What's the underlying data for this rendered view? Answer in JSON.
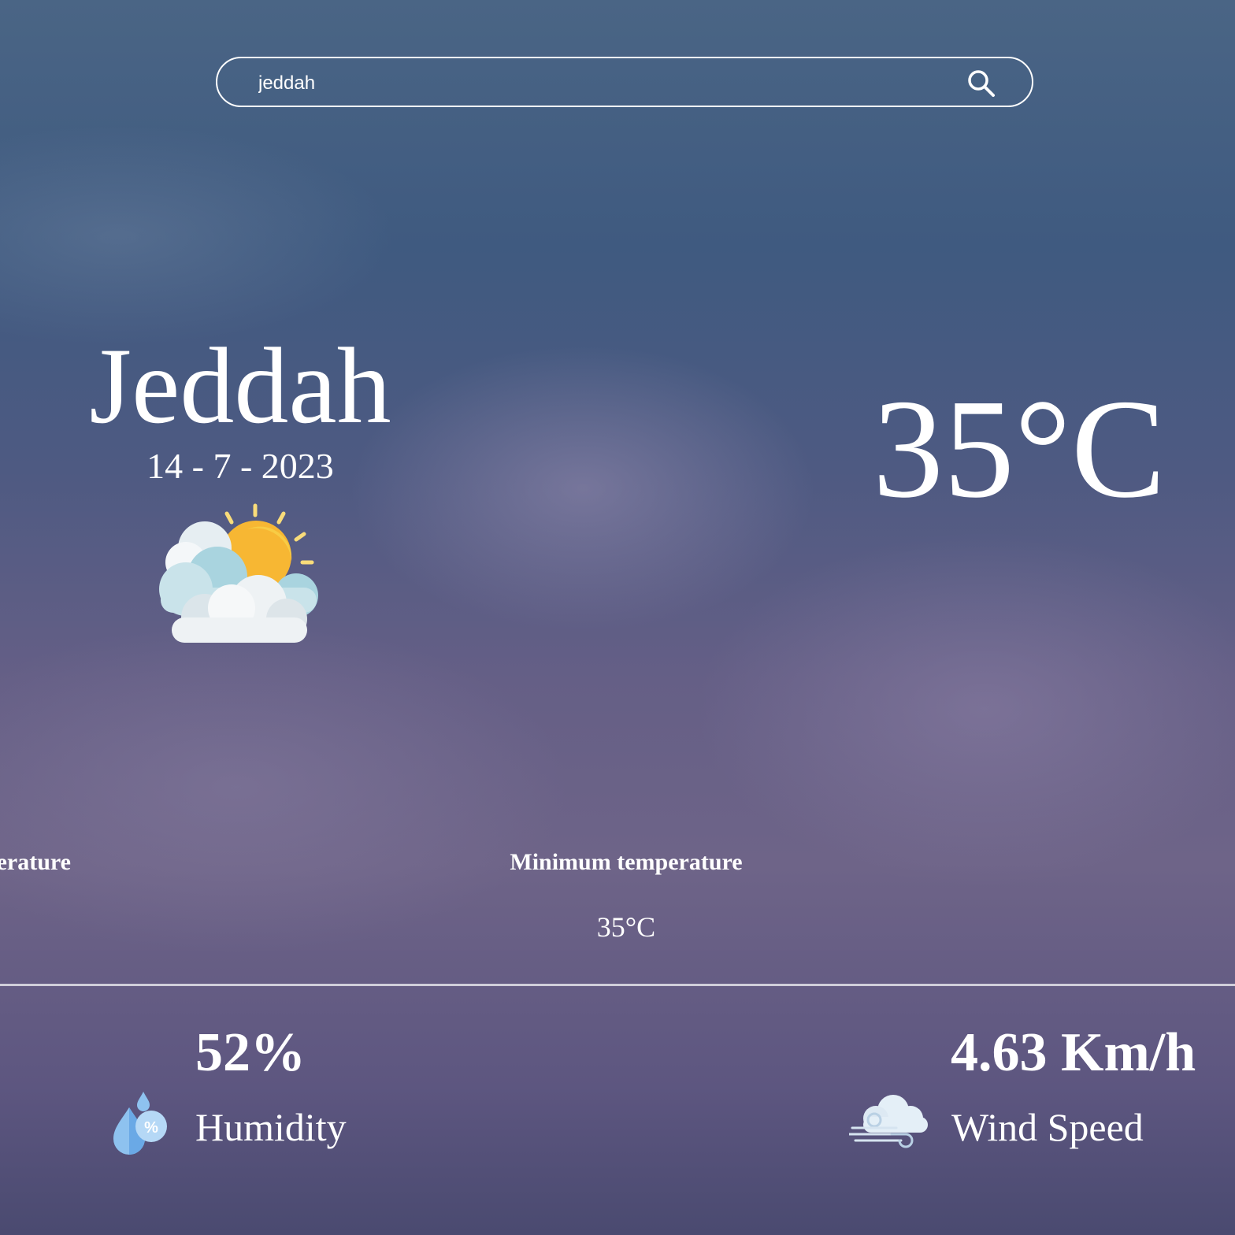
{
  "search": {
    "value": "jeddah"
  },
  "location": {
    "city": "Jeddah",
    "date": "14 - 7 - 2023"
  },
  "current": {
    "temperature": "35°C",
    "condition_icon": "partly-cloudy-icon"
  },
  "temperatures": {
    "max_label_partial": "erature",
    "min_label": "Minimum temperature",
    "min_value": "35°C"
  },
  "stats": {
    "humidity_value": "52%",
    "humidity_label": "Humidity",
    "wind_value": "4.63 Km/h",
    "wind_label": "Wind Speed"
  },
  "colors": {
    "text": "#ffffff",
    "sun": "#f7b733",
    "sun_rays": "#f9dc7a"
  }
}
